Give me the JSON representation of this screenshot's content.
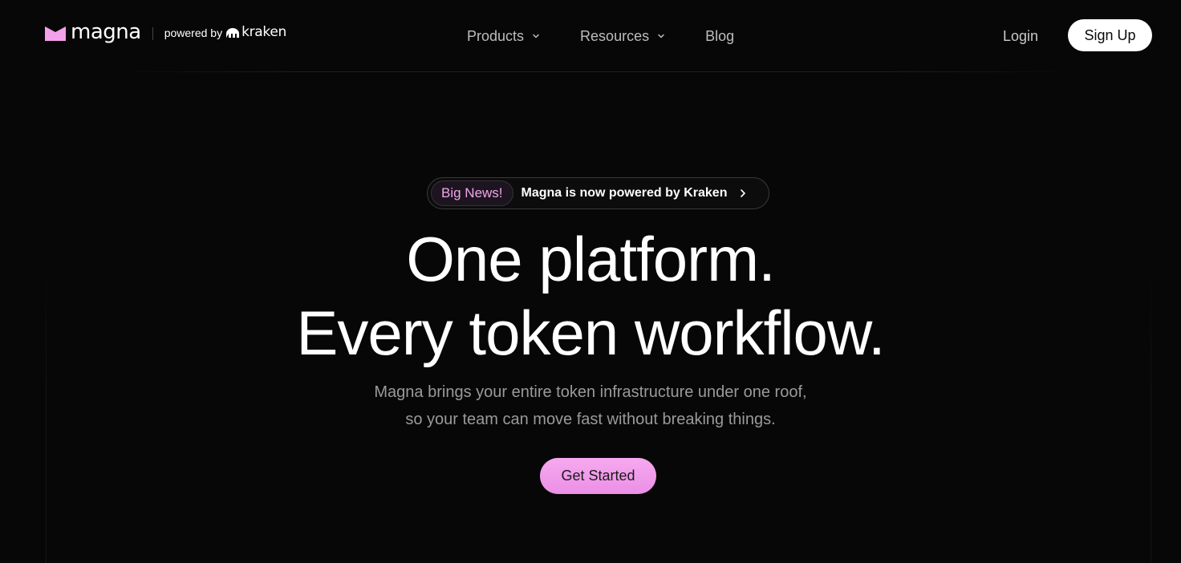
{
  "header": {
    "brand": {
      "name": "magna",
      "powered_by": "powered by",
      "partner": "kraken",
      "brand_color": "#f4a1ec"
    },
    "nav": [
      {
        "label": "Products",
        "has_dropdown": true
      },
      {
        "label": "Resources",
        "has_dropdown": true
      },
      {
        "label": "Blog",
        "has_dropdown": false
      }
    ],
    "login_label": "Login",
    "signup_label": "Sign Up"
  },
  "hero": {
    "badge": {
      "tag": "Big News!",
      "text": "Magna is now powered by Kraken",
      "icon": "chevron-right-icon"
    },
    "headline_line1": "One platform.",
    "headline_line2": "Every token workflow.",
    "subtitle_line1": "Magna brings your entire token infrastructure under one roof,",
    "subtitle_line2": "so your team can move fast without breaking things.",
    "cta_label": "Get Started",
    "cta_color": "#f4a1ec"
  },
  "colors": {
    "background": "#070707",
    "accent": "#f4a1ec",
    "text_primary": "#ffffff",
    "text_muted": "#9a9a9a"
  }
}
